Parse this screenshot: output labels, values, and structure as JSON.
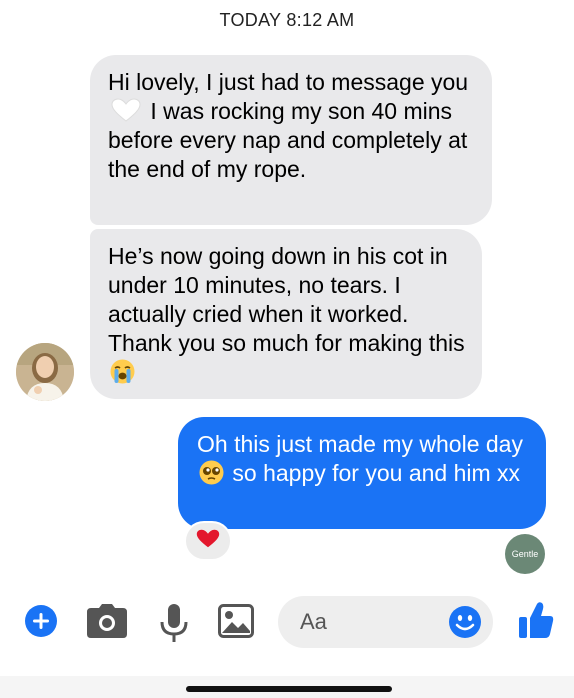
{
  "timestamp": "TODAY 8:12 AM",
  "messages": [
    {
      "direction": "incoming",
      "text_before_emoji": "Hi lovely, I just had to message you",
      "emoji": "white-heart",
      "text_after_emoji": "I was rocking my son 40 mins before every nap and completely at the end of my rope."
    },
    {
      "direction": "incoming",
      "text_before_emoji": "He’s now going down in his cot in under 10 minutes, no tears. I actually cried when it worked. Thank you so much for making this",
      "emoji": "loudly-crying-face"
    },
    {
      "direction": "outgoing",
      "text_before_emoji": "Oh this just made my whole day",
      "emoji": "pleading-face",
      "text_after_emoji": "so happy for you and him xx",
      "reaction": "red-heart"
    }
  ],
  "read_receipt": "Gentle",
  "composer": {
    "placeholder": "Aa"
  },
  "toolbar": [
    "plus-icon",
    "camera-icon",
    "microphone-icon",
    "image-icon",
    "emoji-icon",
    "thumbs-up-icon"
  ],
  "colors": {
    "incoming_bubble": "#e9e9eb",
    "outgoing_bubble": "#1a73f5",
    "accent": "#1a73f5"
  }
}
